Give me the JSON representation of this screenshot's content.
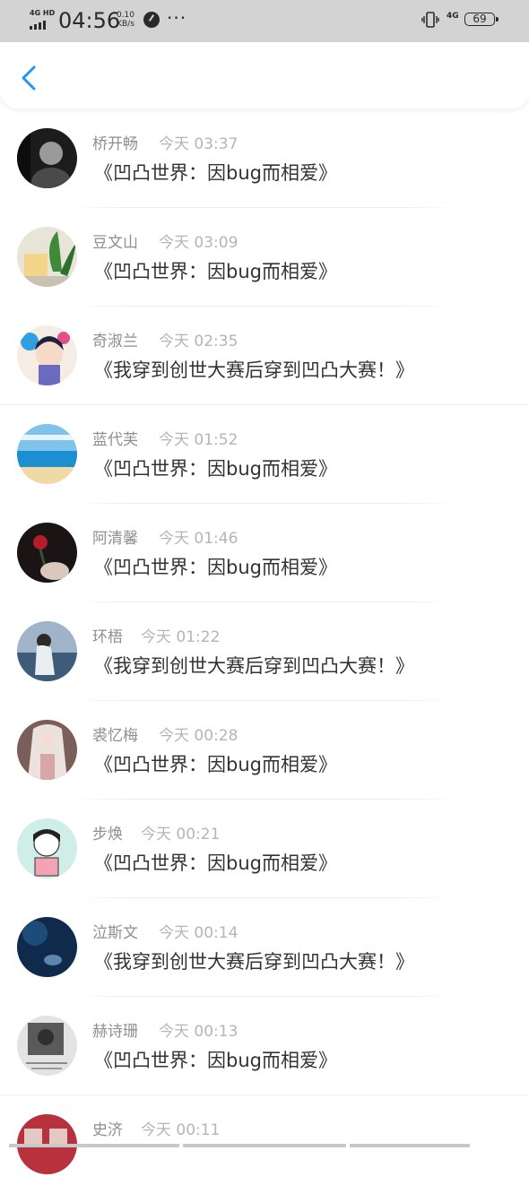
{
  "status_bar": {
    "network_label": "4G HD",
    "time": "04:56",
    "speed_value": "0.10",
    "speed_unit": "KB/s",
    "more_glyph": "···",
    "mobile_type": "4G",
    "battery": "69",
    "icons": [
      "signal-icon",
      "app-notification-icon",
      "more-dots-icon",
      "vibrate-icon",
      "battery-icon"
    ]
  },
  "header": {
    "back_icon": "chevron-left-icon",
    "accent_color": "#2196f3"
  },
  "colors": {
    "name": "#8e8e8e",
    "time": "#b5b5b5",
    "title": "#333333",
    "status_bar_bg": "#d3d3d3"
  },
  "items": [
    {
      "name": "桥开畅",
      "time": "今天 03:37",
      "title": "《凹凸世界：因bug而相爱》",
      "avatar": "avatar-dark-portrait"
    },
    {
      "name": "豆文山",
      "time": "今天 03:09",
      "title": "《凹凸世界：因bug而相爱》",
      "avatar": "avatar-plant"
    },
    {
      "name": "奇淑兰",
      "time": "今天 02:35",
      "title": "《我穿到创世大赛后穿到凹凸大赛！》",
      "avatar": "avatar-anime-girl"
    },
    {
      "name": "蓝代芙",
      "time": "今天 01:52",
      "title": "《凹凸世界：因bug而相爱》",
      "avatar": "avatar-sea"
    },
    {
      "name": "阿清馨",
      "time": "今天 01:46",
      "title": "《凹凸世界：因bug而相爱》",
      "avatar": "avatar-rose"
    },
    {
      "name": "环梧",
      "time": "今天 01:22",
      "title": "《我穿到创世大赛后穿到凹凸大赛！》",
      "avatar": "avatar-girl-sea"
    },
    {
      "name": "裘忆梅",
      "time": "今天 00:28",
      "title": "《凹凸世界：因bug而相爱》",
      "avatar": "avatar-white-hair"
    },
    {
      "name": "步焕",
      "time": "今天 00:21",
      "title": "《凹凸世界：因bug而相爱》",
      "avatar": "avatar-cartoon-girl"
    },
    {
      "name": "泣斯文",
      "time": "今天 00:14",
      "title": "《我穿到创世大赛后穿到凹凸大赛！》",
      "avatar": "avatar-blue-night"
    },
    {
      "name": "赫诗珊",
      "time": "今天 00:13",
      "title": "《凹凸世界：因bug而相爱》",
      "avatar": "avatar-grey-photo"
    },
    {
      "name": "史济",
      "time": "今天 00:11",
      "title": "",
      "avatar": "avatar-red-train"
    }
  ]
}
